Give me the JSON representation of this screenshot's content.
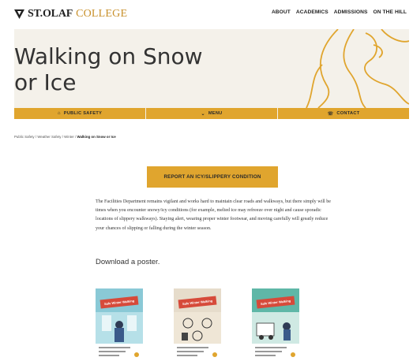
{
  "header": {
    "logo_text": "ST.OLAF",
    "logo_college": "COLLEGE",
    "nav": [
      "ABOUT",
      "ACADEMICS",
      "ADMISSIONS",
      "ON THE HILL"
    ]
  },
  "hero": {
    "title_line1": "Walking on Snow",
    "title_line2": "or Ice"
  },
  "actionbar": {
    "public_safety": "PUBLIC SAFETY",
    "menu": "MENU",
    "contact": "CONTACT"
  },
  "breadcrumb": {
    "items": [
      "Public Safety",
      "Weather Safety",
      "Winter"
    ],
    "sep": " / ",
    "current": "Walking on Snow or Ice"
  },
  "report_button": "REPORT AN ICY/SLIPPERY CONDITION",
  "body_text": "The Facilities Department remains vigilant and works hard to maintain clear roads and walkways, but there simply will be times when you encounter snowy/icy conditions (for example, melted ice may refreeze over night and cause sporadic locations of slippery walkways).  Staying alert, wearing proper winter footwear, and moving carefully will greatly reduce your chances of slipping or falling during the winter season.",
  "download_heading": "Download a poster.",
  "posters": [
    {
      "banner": "Safe Winter Walking"
    },
    {
      "banner": "Safe Winter Walking"
    },
    {
      "banner": "Safe Winter Walking"
    }
  ],
  "colors": {
    "gold": "#e0a52e",
    "hero_bg": "#f4f1ea",
    "banner_red": "#d64a3a"
  }
}
